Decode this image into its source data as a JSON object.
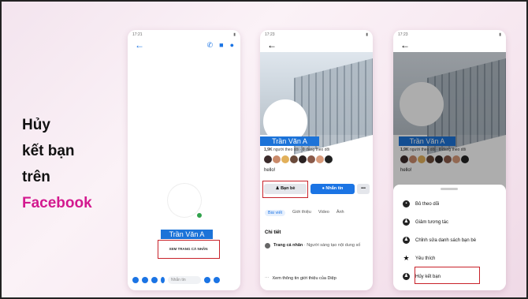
{
  "title": {
    "line1": "Hủy",
    "line2": "kết bạn",
    "line3": "trên",
    "line4": "Facebook"
  },
  "phone1": {
    "status_time": "17:21",
    "name": "Trần Văn A",
    "view_profile": "XEM TRANG CÁ NHÂN",
    "message_placeholder": "Nhắn tin"
  },
  "phone2": {
    "status_time": "17:23",
    "name": "Trần Văn A",
    "stats_followers": "1,9K",
    "stats_followers_label": "người theo dõi",
    "stats_following": "0",
    "stats_following_label": "đang theo dõi",
    "hello": "hello!",
    "btn_friends": "Bạn bè",
    "btn_message": "Nhắn tin",
    "btn_more": "•••",
    "tabs": [
      "Bài viết",
      "Giới thiệu",
      "Video",
      "Ảnh"
    ],
    "details_title": "Chi tiết",
    "detail_row_bold": "Trang cá nhân",
    "detail_row_rest": "· Người sáng tạo nội dung số",
    "see_more": "Xem thông tin giới thiệu của Diệp"
  },
  "phone3": {
    "status_time": "17:23",
    "name": "Trần Văn A",
    "stats_followers": "1,9K",
    "stats_followers_label": "người theo dõi",
    "stats_following": "0",
    "stats_following_label": "đang theo dõi",
    "hello": "hello!",
    "menu": [
      "Bỏ theo dõi",
      "Giảm tương tác",
      "Chỉnh sửa danh sách bạn bè",
      "Yêu thích",
      "Hủy kết bạn"
    ]
  },
  "colors": {
    "accent": "#d3198f",
    "fb_blue": "#1c73d8",
    "highlight": "#c8222a"
  }
}
